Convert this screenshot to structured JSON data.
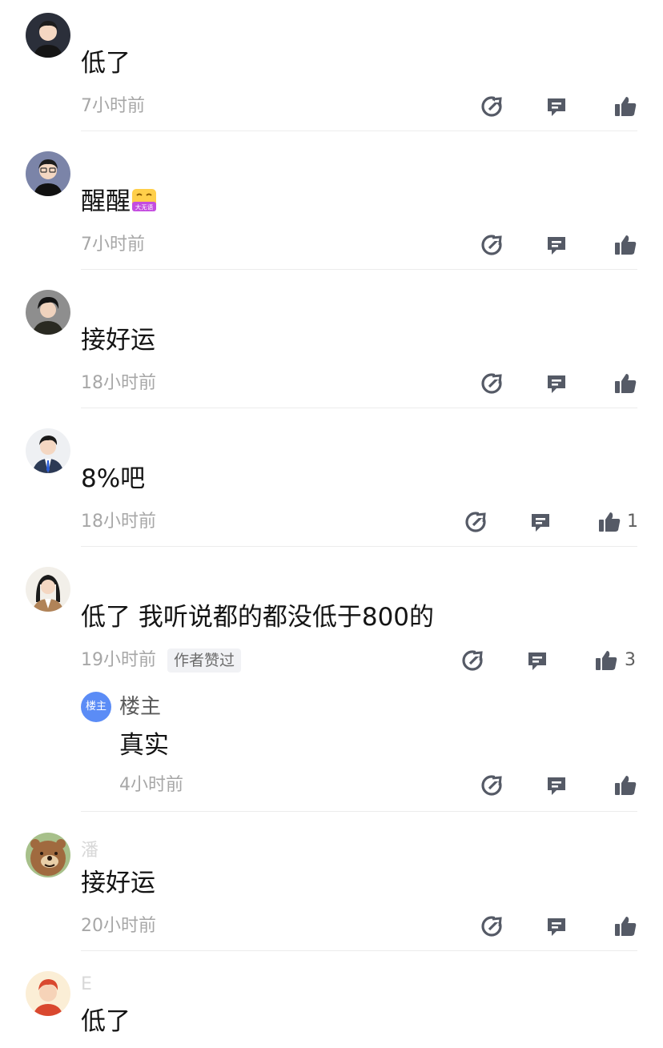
{
  "comments": [
    {
      "username": "",
      "content": "低了",
      "time": "7小时前",
      "likes": "",
      "badge": "",
      "avatar": "man-black-hair-avatar"
    },
    {
      "username": "",
      "content": "醒醒",
      "time": "7小时前",
      "likes": "",
      "badge": "",
      "avatar": "man-glasses-avatar",
      "sticker": "大无语"
    },
    {
      "username": "",
      "content": "接好运",
      "time": "18小时前",
      "likes": "",
      "badge": "",
      "avatar": "man-dark-coat-avatar"
    },
    {
      "username": "",
      "content": "8%吧",
      "time": "18小时前",
      "likes": "1",
      "badge": "",
      "avatar": "man-suit-avatar"
    },
    {
      "username": "",
      "content": "低了 我听说都的都没低于800的",
      "time": "19小时前",
      "likes": "3",
      "badge": "作者赞过",
      "avatar": "woman-long-hair-avatar",
      "reply": {
        "avatar_label": "楼主",
        "name": "楼主",
        "content": "真实",
        "time": "4小时前"
      }
    },
    {
      "username": "潘",
      "content": "接好运",
      "time": "20小时前",
      "likes": "",
      "badge": "",
      "avatar": "bear-avatar"
    },
    {
      "username": "E",
      "content": "低了",
      "time": "",
      "likes": "",
      "badge": "",
      "avatar": "man-red-hair-avatar"
    }
  ],
  "icons": {
    "share": "share-arrow-icon",
    "reply": "comment-bubble-icon",
    "like": "thumbs-up-icon"
  },
  "colors": {
    "icon": "#555a66",
    "meta": "#a7a7a7",
    "reply_avatar": "#5b8cf6",
    "badge_bg": "#f1f2f5"
  }
}
